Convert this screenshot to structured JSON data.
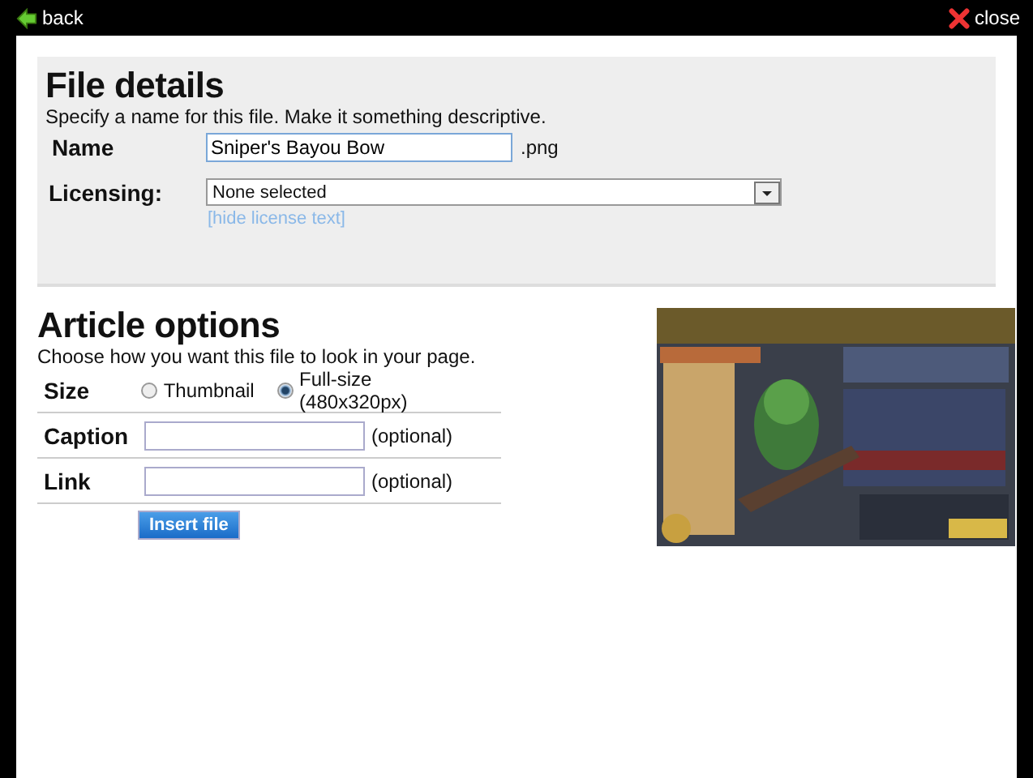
{
  "top_bar": {
    "back": "back",
    "close": "close"
  },
  "file_details": {
    "title": "File details",
    "description": "Specify a name for this file. Make it something descriptive.",
    "name_label": "Name",
    "name_value": "Sniper's Bayou Bow",
    "extension": ".png",
    "licensing_label": "Licensing:",
    "licensing_value": "None selected",
    "hide_license_link": "[hide license text]"
  },
  "article_options": {
    "title": "Article options",
    "description": "Choose how you want this file to look in your page.",
    "size_label": "Size",
    "size_options": [
      {
        "label": "Thumbnail",
        "selected": false
      },
      {
        "label": "Full-size (480x320px)",
        "selected": true
      }
    ],
    "caption_label": "Caption",
    "caption_hint": "(optional)",
    "link_label": "Link",
    "link_hint": "(optional)",
    "insert_button": "Insert file"
  }
}
